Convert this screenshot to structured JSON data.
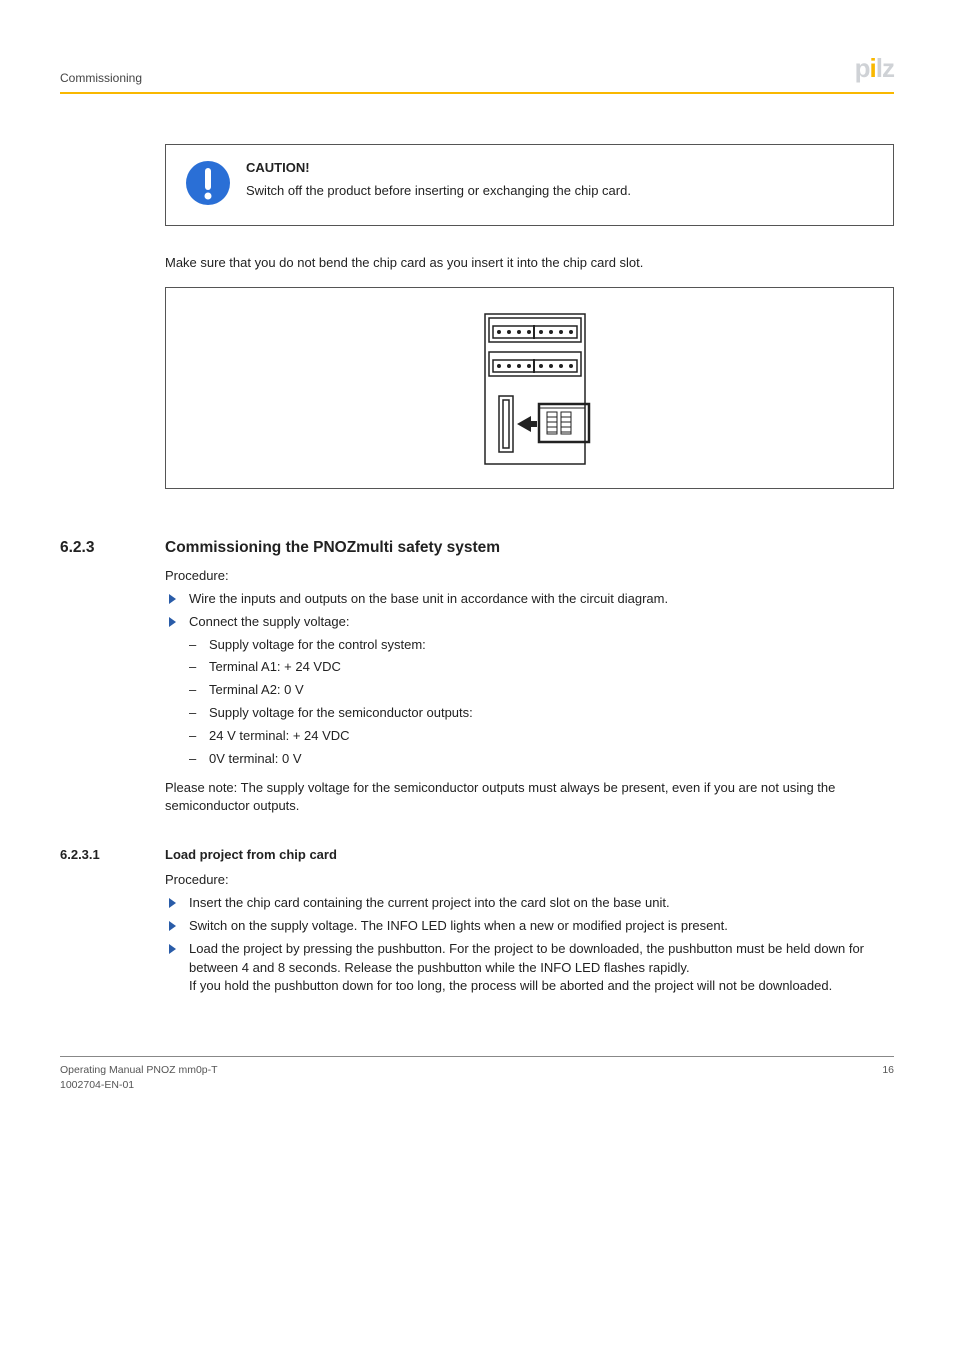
{
  "header": {
    "section": "Commissioning",
    "logo_text": "pilz"
  },
  "caution": {
    "heading": "CAUTION!",
    "text": "Switch off the product before inserting or exchanging the chip card."
  },
  "chip_card_note": "Make sure that you do not bend the chip card as you insert it into the chip card slot.",
  "section_623": {
    "number": "6.2.3",
    "title": "Commissioning the PNOZmulti safety system",
    "procedure_label": "Procedure:",
    "bullets": [
      "Wire the inputs and outputs on the base unit in accordance with the circuit diagram.",
      "Connect the supply voltage:"
    ],
    "dashes": [
      "Supply voltage for the control system:",
      "Terminal A1: + 24 VDC",
      "Terminal A2: 0 V",
      "Supply voltage for the semiconductor outputs:",
      "24 V terminal: + 24 VDC",
      "0V terminal: 0 V"
    ],
    "note": "Please note: The supply voltage for the semiconductor outputs must always be present, even if you are not using the semiconductor outputs."
  },
  "section_6231": {
    "number": "6.2.3.1",
    "title": "Load project from chip card",
    "procedure_label": "Procedure:",
    "bullets": [
      "Insert the chip card containing the current project into the card slot on the base unit.",
      "Switch on the supply voltage. The INFO LED lights when a new or modified project is present.",
      "Load the project by pressing the pushbutton. For the project to be downloaded, the pushbutton must be held down for between 4 and 8 seconds. Release the pushbutton while the INFO LED flashes rapidly."
    ],
    "bullet3_tail": "If you hold the pushbutton down for too long, the process will be aborted and the project will not be downloaded."
  },
  "footer": {
    "left_line1": "Operating Manual PNOZ mm0p-T",
    "left_line2": "1002704-EN-01",
    "page": "16"
  }
}
